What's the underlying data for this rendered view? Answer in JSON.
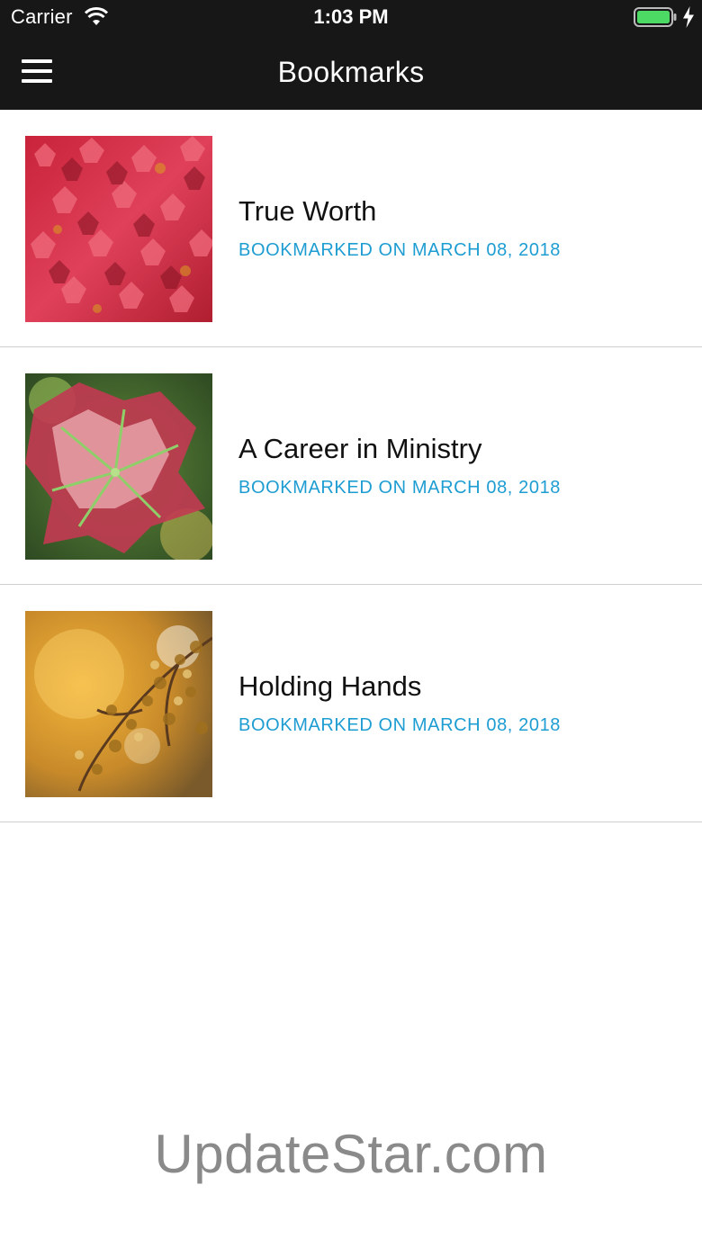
{
  "status_bar": {
    "carrier": "Carrier",
    "time": "1:03 PM",
    "battery_color": "#4cd964"
  },
  "nav": {
    "title": "Bookmarks",
    "menu_icon": "hamburger-menu-icon"
  },
  "bookmarks": [
    {
      "title": "True Worth",
      "meta": "BOOKMARKED ON MARCH 08, 2018",
      "image": "red-ivy-leaves-photo"
    },
    {
      "title": "A Career in Ministry",
      "meta": "BOOKMARKED ON MARCH 08, 2018",
      "image": "autumn-grape-leaf-photo"
    },
    {
      "title": "Holding Hands",
      "meta": "BOOKMARKED ON MARCH 08, 2018",
      "image": "golden-autumn-branches-photo"
    }
  ],
  "watermark": "UpdateStar.com",
  "colors": {
    "header_bg": "#171717",
    "accent": "#1e9dd2",
    "divider": "#cfcfcf"
  }
}
